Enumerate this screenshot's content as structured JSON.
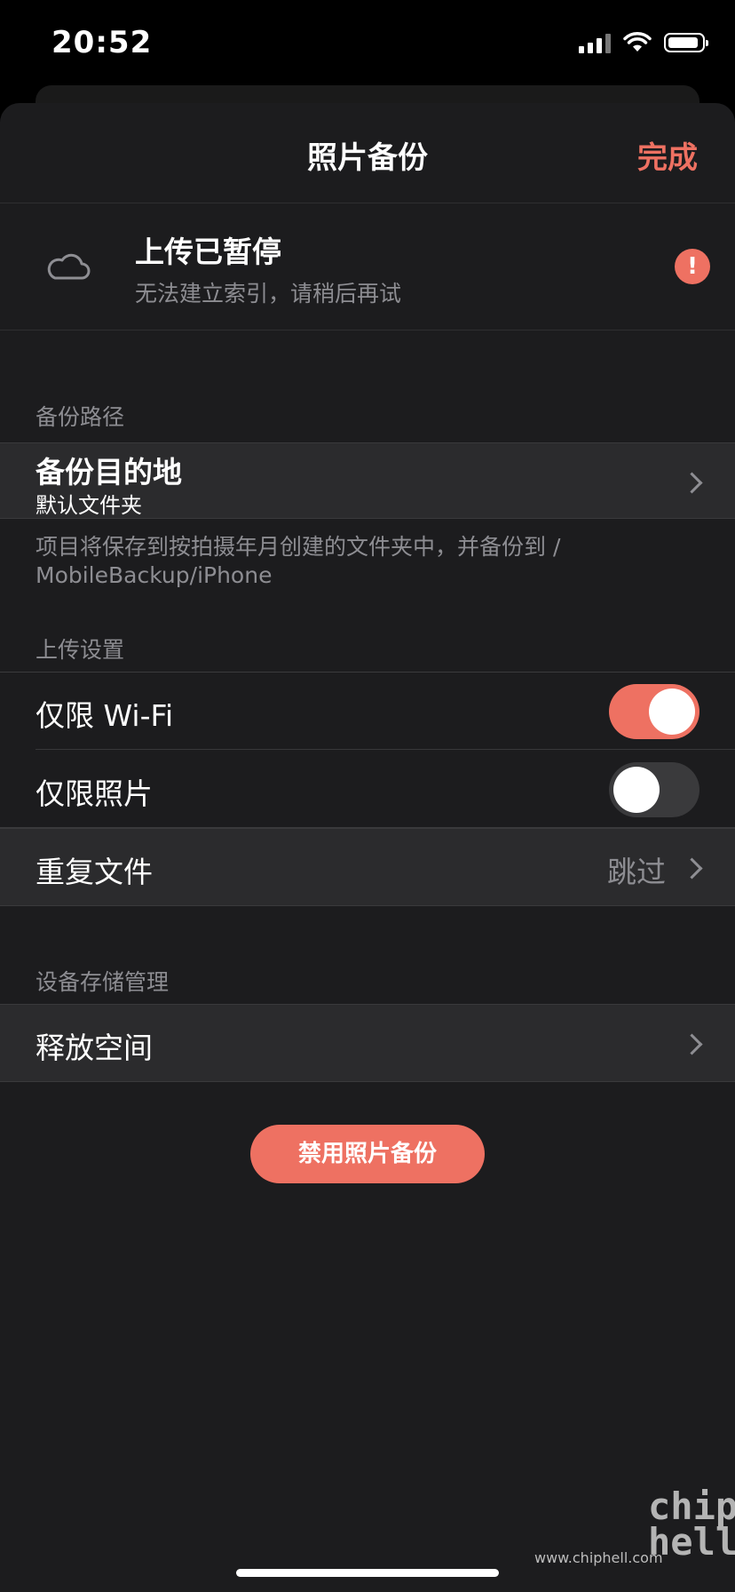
{
  "status_bar": {
    "time": "20:52"
  },
  "nav": {
    "title": "照片备份",
    "done": "完成"
  },
  "upload_status": {
    "title": "上传已暂停",
    "subtitle": "无法建立索引，请稍后再试",
    "alert": "!"
  },
  "sections": {
    "backup_path": "备份路径",
    "upload_settings": "上传设置",
    "storage": "设备存储管理"
  },
  "destination": {
    "title": "备份目的地",
    "value": "默认文件夹"
  },
  "note": "项目将保存到按拍摄年月创建的文件夹中，并备份到 / MobileBackup/iPhone",
  "wifi_only": {
    "label": "仅限 Wi-Fi",
    "on": true
  },
  "photos_only": {
    "label": "仅限照片",
    "on": false
  },
  "duplicates": {
    "label": "重复文件",
    "value": "跳过"
  },
  "free_space": {
    "label": "释放空间"
  },
  "disable_button": "禁用照片备份",
  "watermark": {
    "text": "www.chiphell.com",
    "logo": "chip hell"
  },
  "colors": {
    "accent": "#ee7162",
    "background": "#1c1c1e",
    "cell": "#2b2b2d",
    "secondary_text": "#8d8d92"
  }
}
